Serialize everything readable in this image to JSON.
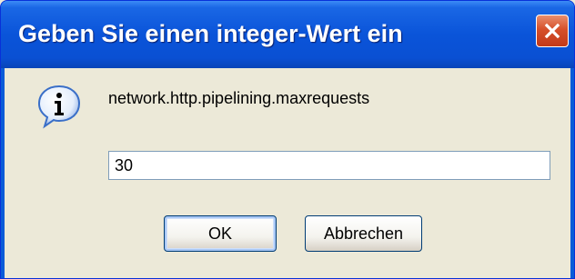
{
  "window": {
    "title": "Geben Sie einen integer-Wert ein",
    "close_icon": "close-icon"
  },
  "dialog": {
    "icon": "info-icon",
    "prompt": "network.http.pipelining.maxrequests",
    "input_value": "30"
  },
  "buttons": {
    "ok_label": "OK",
    "cancel_label": "Abbrechen"
  },
  "colors": {
    "titlebar": "#0A54D9",
    "client_background": "#ECE9D8",
    "close_button": "#D6502A"
  }
}
